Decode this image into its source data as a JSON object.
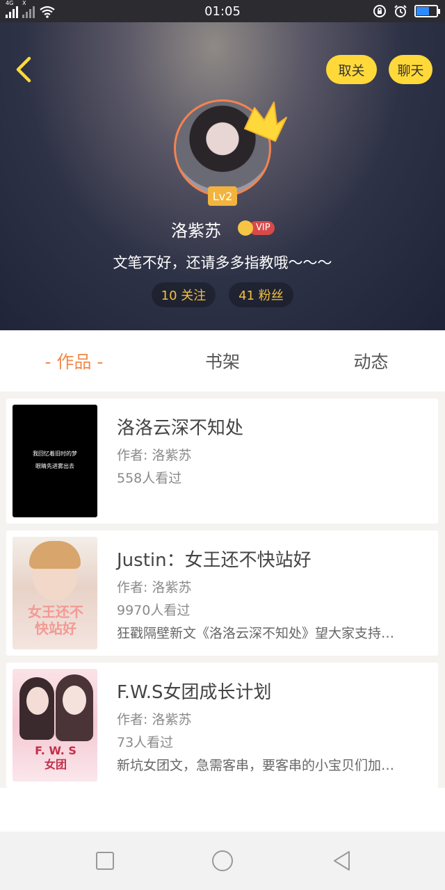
{
  "status_bar": {
    "time": "01:05",
    "network_tag": "4G",
    "network_tag_2": "X",
    "battery_level": 0.6,
    "icons": [
      "signal-icon",
      "wifi-icon",
      "lock-rotation-icon",
      "alarm-icon",
      "battery-icon"
    ]
  },
  "header": {
    "follow_button": "取关",
    "chat_button": "聊天",
    "level_badge": "Lv2",
    "username": "洛紫苏",
    "vip_label": "VIP",
    "bio": "文笔不好，还请多多指教哦～～～",
    "following": "10 关注",
    "fans": "41 粉丝"
  },
  "tabs": [
    {
      "label": "- 作品 -",
      "active": true
    },
    {
      "label": "书架",
      "active": false
    },
    {
      "label": "动态",
      "active": false
    }
  ],
  "works": [
    {
      "title": "洛洛云深不知处",
      "author": "作者: 洛紫苏",
      "views": "558人看过",
      "description": "",
      "cover_text": [
        "我回忆着旧时的梦",
        "眼睛先进雾出去"
      ]
    },
    {
      "title": "Justin：女王还不快站好",
      "author": "作者: 洛紫苏",
      "views": "9970人看过",
      "description": "狂戳隔壁新文《洛洛云深不知处》望大家支持…",
      "cover_text": [
        "女王还不",
        "快站好"
      ]
    },
    {
      "title": "F.W.S女团成长计划",
      "author": "作者: 洛紫苏",
      "views": "73人看过",
      "description": "新坑女团文，急需客串，要客串的小宝贝们加…",
      "cover_text": [
        "F. W. S",
        "女团"
      ]
    }
  ],
  "colors": {
    "accent": "#f08a4b",
    "pill": "#ffd93a",
    "stat_text": "#f2c23c",
    "vip": "#d84a4a"
  }
}
